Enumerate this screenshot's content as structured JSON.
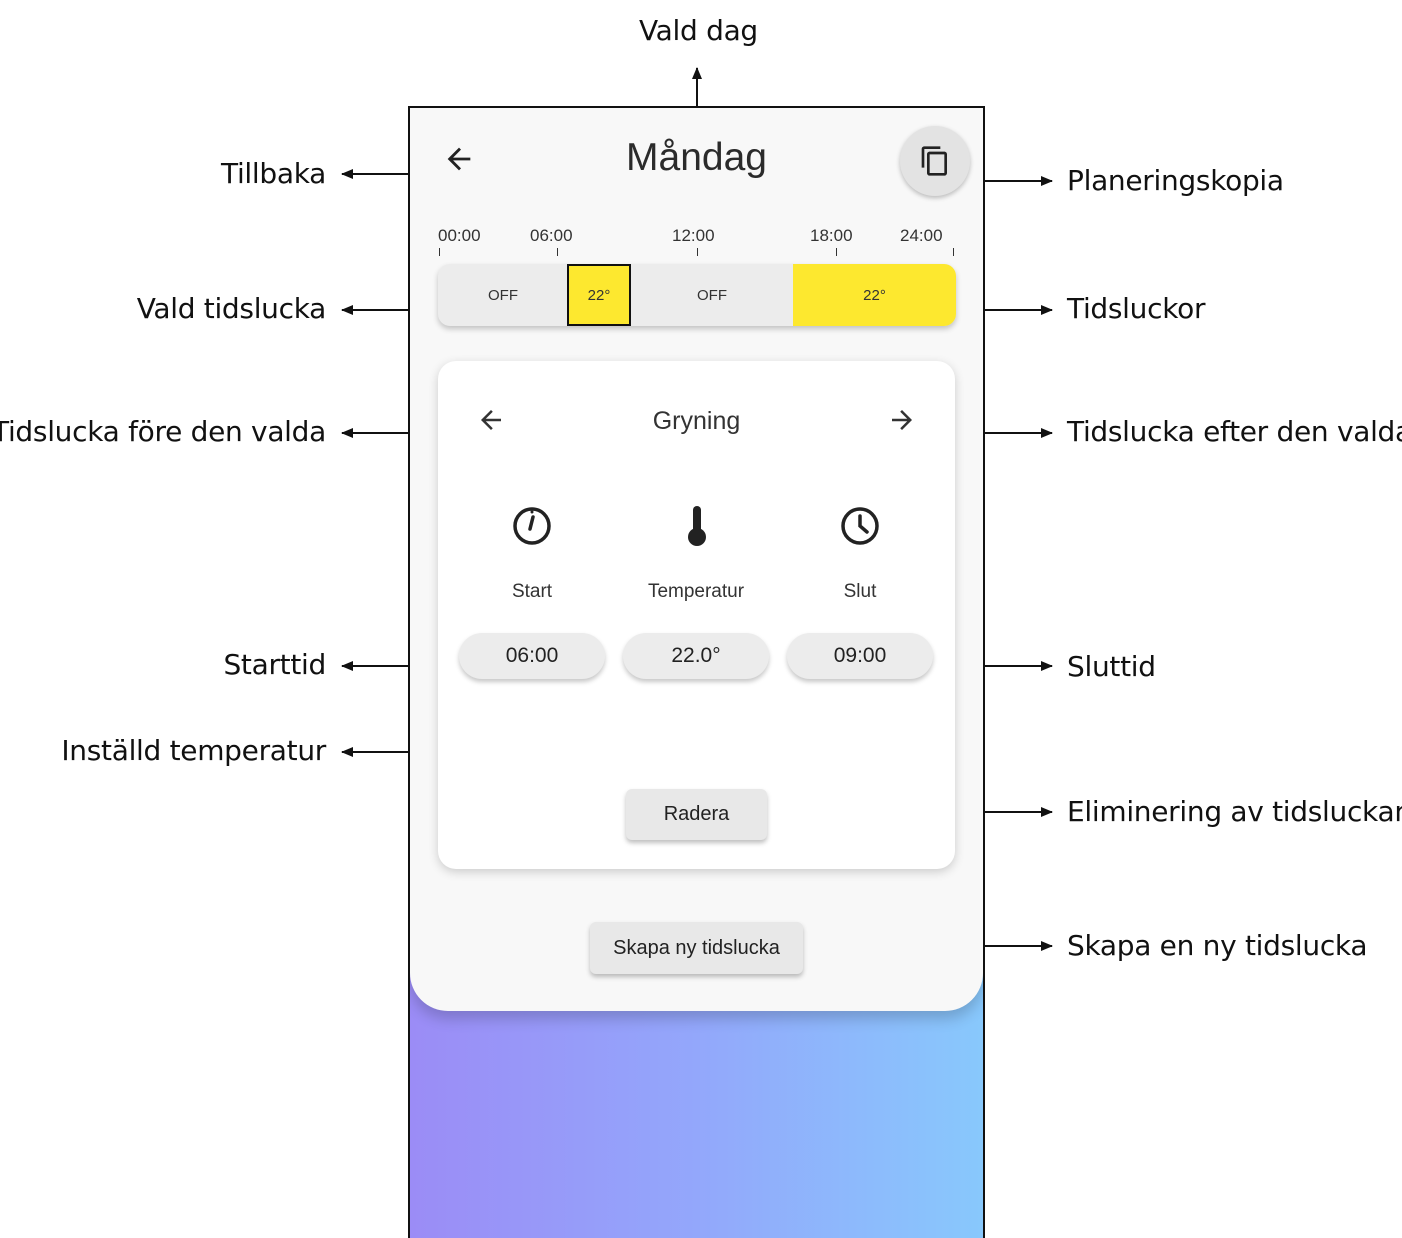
{
  "annotations": {
    "vald_dag": "Vald dag",
    "tillbaka": "Tillbaka",
    "planeringskopia": "Planeringskopia",
    "vald_tidslucka": "Vald tidslucka",
    "tidsluckor": "Tidsluckor",
    "tidslucka_fore": "Tidslucka före den valda",
    "tidslucka_efter": "Tidslucka efter den valda",
    "starttid": "Starttid",
    "sluttid": "Sluttid",
    "installd_temperatur": "Inställd temperatur",
    "eliminering": "Eliminering av tidsluckan",
    "skapa_en_ny": "Skapa en ny tidslucka"
  },
  "header": {
    "title": "Måndag",
    "back_icon": "arrow-left-icon",
    "copy_icon": "copy-icon"
  },
  "timeline": {
    "ticks": [
      "00:00",
      "06:00",
      "12:00",
      "18:00",
      "24:00"
    ],
    "slots": [
      {
        "label": "OFF",
        "start": "00:00",
        "end": "06:00",
        "color": "#ececec",
        "selected": false
      },
      {
        "label": "22°",
        "start": "06:00",
        "end": "09:00",
        "color": "#fde82f",
        "selected": true
      },
      {
        "label": "OFF",
        "start": "09:00",
        "end": "18:00",
        "color": "#ececec",
        "selected": false
      },
      {
        "label": "22°",
        "start": "18:00",
        "end": "24:00",
        "color": "#fde82f",
        "selected": false
      }
    ]
  },
  "detail": {
    "name": "Gryning",
    "start_label": "Start",
    "temp_label": "Temperatur",
    "end_label": "Slut",
    "start_value": "06:00",
    "temp_value": "22.0°",
    "end_value": "09:00",
    "delete_label": "Radera"
  },
  "create_label": "Skapa ny tidslucka",
  "colors": {
    "slot_active": "#fde82f",
    "slot_off": "#ececec",
    "gradient_start": "#9b8cf6",
    "gradient_end": "#88c8fc"
  }
}
